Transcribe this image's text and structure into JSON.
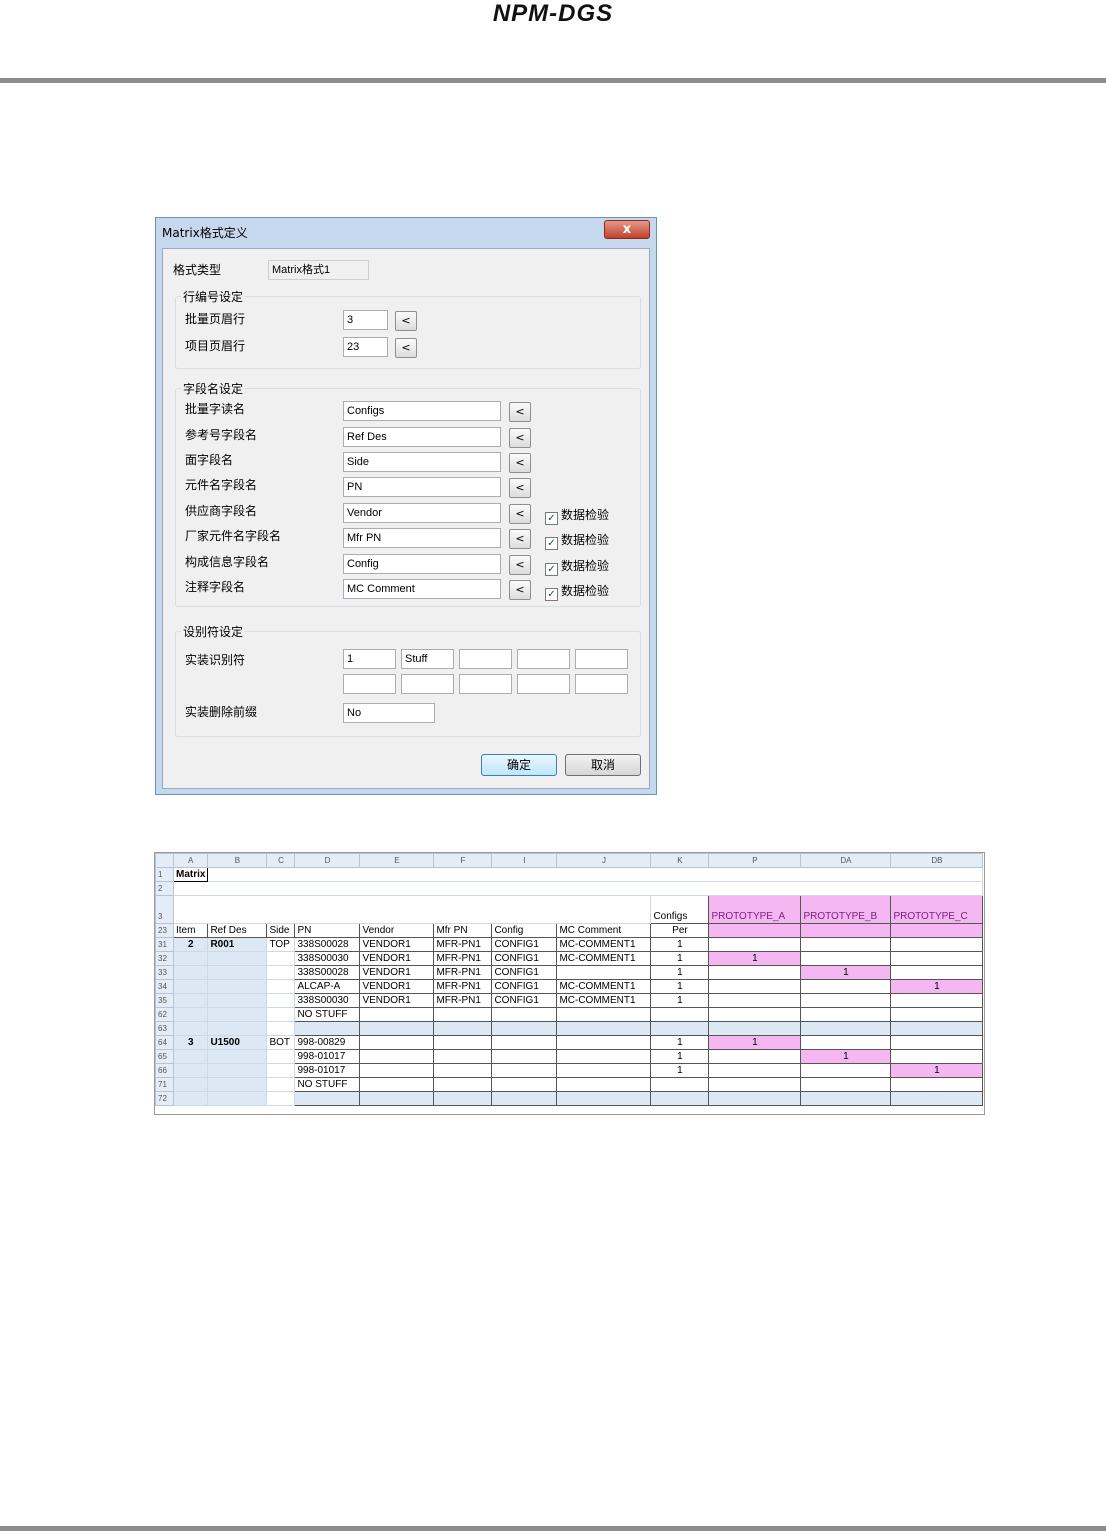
{
  "page": {
    "title": "NPM-DGS"
  },
  "dialog": {
    "title": "Matrix格式定义",
    "close_label": "x",
    "format_type_label": "格式类型",
    "format_type_value": "Matrix格式1",
    "row_group": {
      "caption": "行编号设定",
      "rows": [
        {
          "label": "批量页眉行",
          "value": "3",
          "button": "<"
        },
        {
          "label": "项目页眉行",
          "value": "23",
          "button": "<"
        }
      ]
    },
    "field_group": {
      "caption": "字段名设定",
      "rows": [
        {
          "label": "批量字读名",
          "value": "Configs",
          "button": "<",
          "check": ""
        },
        {
          "label": "参考号字段名",
          "value": "Ref Des",
          "button": "<",
          "check": ""
        },
        {
          "label": "面字段名",
          "value": "Side",
          "button": "<",
          "check": ""
        },
        {
          "label": "元件名字段名",
          "value": "PN",
          "button": "<",
          "check": ""
        },
        {
          "label": "供应商字段名",
          "value": "Vendor",
          "button": "<",
          "check": "数据检验"
        },
        {
          "label": "厂家元件名字段名",
          "value": "Mfr PN",
          "button": "<",
          "check": "数据检验"
        },
        {
          "label": "构成信息字段名",
          "value": "Config",
          "button": "<",
          "check": "数据检验"
        },
        {
          "label": "注释字段名",
          "value": "MC Comment",
          "button": "<",
          "check": "数据检验"
        }
      ]
    },
    "id_group": {
      "caption": "设别符设定",
      "mount_label": "实装识别符",
      "mount_row1": [
        "1",
        "Stuff",
        "",
        "",
        ""
      ],
      "mount_row2": [
        "",
        "",
        "",
        "",
        ""
      ],
      "prefix_label": "实装删除前缀",
      "prefix_value": "No"
    },
    "ok_label": "确定",
    "cancel_label": "取消"
  },
  "sheet": {
    "col_headers": [
      "A",
      "B",
      "C",
      "D",
      "E",
      "F",
      "I",
      "J",
      "K",
      "P",
      "DA",
      "DB"
    ],
    "a1_text": "Matrix",
    "row3": {
      "configs": "Configs",
      "protos": [
        "PROTOTYPE_A",
        "PROTOTYPE_B",
        "PROTOTYPE_C"
      ]
    },
    "header_row": [
      "Item",
      "Ref Des",
      "Side",
      "PN",
      "Vendor",
      "Mfr PN",
      "Config",
      "MC Comment",
      "Per"
    ],
    "rows": [
      {
        "n": "31",
        "item": "2",
        "ref": "R001",
        "side": "TOP",
        "pn": "338S00028",
        "vendor": "VENDOR1",
        "mfr": "MFR-PN1",
        "config": "CONFIG1",
        "mc": "MC-COMMENT1",
        "per": "1",
        "pa": "",
        "pb": "",
        "pc": ""
      },
      {
        "n": "32",
        "item": "",
        "ref": "",
        "side": "",
        "pn": "338S00030",
        "vendor": "VENDOR1",
        "mfr": "MFR-PN1",
        "config": "CONFIG1",
        "mc": "MC-COMMENT1",
        "per": "1",
        "pa": "1",
        "pb": "",
        "pc": ""
      },
      {
        "n": "33",
        "item": "",
        "ref": "",
        "side": "",
        "pn": "338S00028",
        "vendor": "VENDOR1",
        "mfr": "MFR-PN1",
        "config": "CONFIG1",
        "mc": "",
        "per": "1",
        "pa": "",
        "pb": "1",
        "pc": ""
      },
      {
        "n": "34",
        "item": "",
        "ref": "",
        "side": "",
        "pn": "ALCAP-A",
        "vendor": "VENDOR1",
        "mfr": "MFR-PN1",
        "config": "CONFIG1",
        "mc": "MC-COMMENT1",
        "per": "1",
        "pa": "",
        "pb": "",
        "pc": "1"
      },
      {
        "n": "35",
        "item": "",
        "ref": "",
        "side": "",
        "pn": "338S00030",
        "vendor": "VENDOR1",
        "mfr": "MFR-PN1",
        "config": "CONFIG1",
        "mc": "MC-COMMENT1",
        "per": "1",
        "pa": "",
        "pb": "",
        "pc": ""
      },
      {
        "n": "62",
        "item": "",
        "ref": "",
        "side": "",
        "pn": "NO STUFF",
        "vendor": "",
        "mfr": "",
        "config": "",
        "mc": "",
        "per": "",
        "pa": "",
        "pb": "",
        "pc": ""
      },
      {
        "n": "63",
        "item": "",
        "ref": "",
        "side": "",
        "pn": "",
        "vendor": "",
        "mfr": "",
        "config": "",
        "mc": "",
        "per": "",
        "pa": "",
        "pb": "",
        "pc": ""
      },
      {
        "n": "64",
        "item": "3",
        "ref": "U1500",
        "side": "BOT",
        "pn": "998-00829",
        "vendor": "",
        "mfr": "",
        "config": "",
        "mc": "",
        "per": "1",
        "pa": "1",
        "pb": "",
        "pc": ""
      },
      {
        "n": "65",
        "item": "",
        "ref": "",
        "side": "",
        "pn": "998-01017",
        "vendor": "",
        "mfr": "",
        "config": "",
        "mc": "",
        "per": "1",
        "pa": "",
        "pb": "1",
        "pc": ""
      },
      {
        "n": "66",
        "item": "",
        "ref": "",
        "side": "",
        "pn": "998-01017",
        "vendor": "",
        "mfr": "",
        "config": "",
        "mc": "",
        "per": "1",
        "pa": "",
        "pb": "",
        "pc": "1"
      },
      {
        "n": "71",
        "item": "",
        "ref": "",
        "side": "",
        "pn": "NO STUFF",
        "vendor": "",
        "mfr": "",
        "config": "",
        "mc": "",
        "per": "",
        "pa": "",
        "pb": "",
        "pc": ""
      },
      {
        "n": "72",
        "item": "",
        "ref": "",
        "side": "",
        "pn": "",
        "vendor": "",
        "mfr": "",
        "config": "",
        "mc": "",
        "per": "",
        "pa": "",
        "pb": "",
        "pc": ""
      }
    ]
  },
  "colors": {
    "pink": "#f5b7f2",
    "light_blue": "#dce9f5",
    "dialog_frame": "#c6d8ee",
    "close_red": "#c2412b"
  }
}
